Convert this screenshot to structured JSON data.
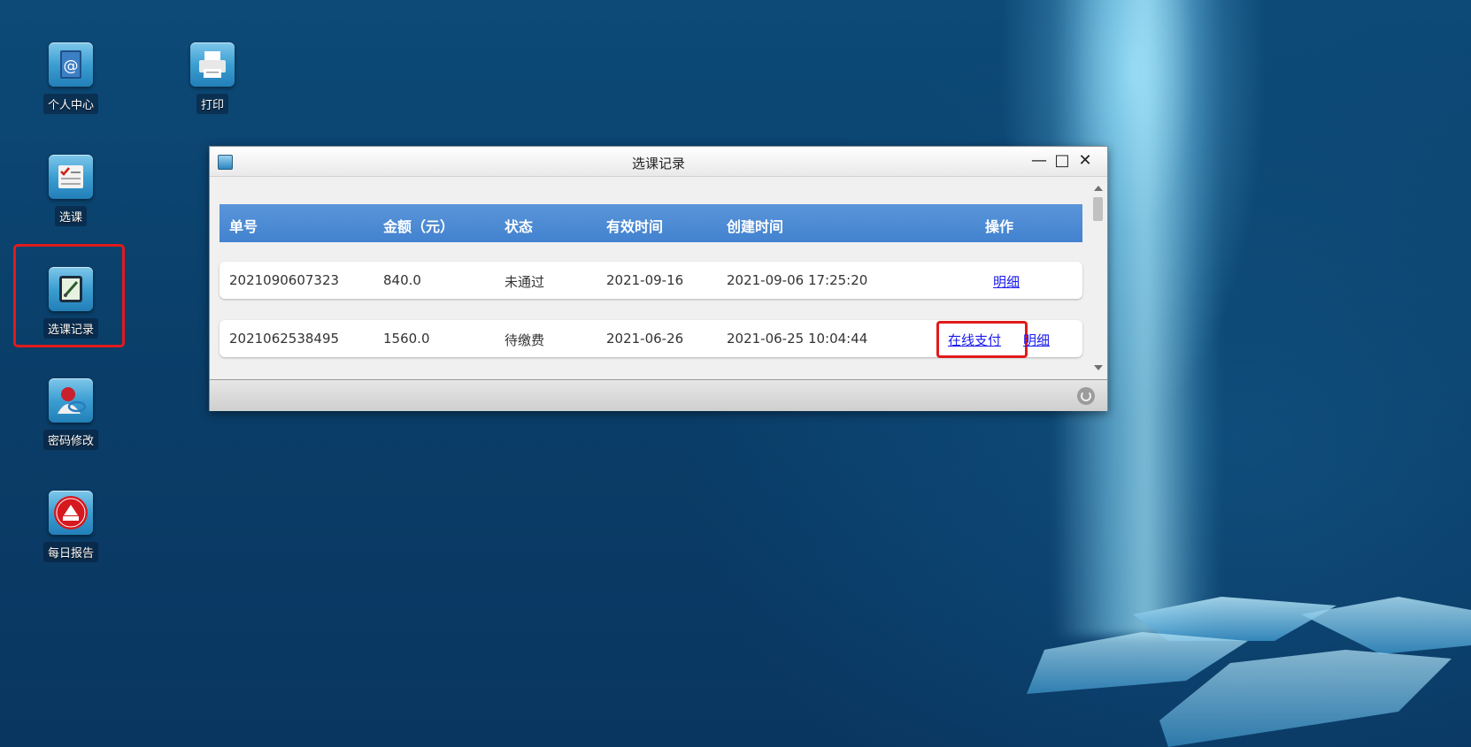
{
  "desktop": {
    "icons": [
      {
        "label": "个人中心",
        "icon": "address-book-icon"
      },
      {
        "label": "打印",
        "icon": "printer-icon"
      },
      {
        "label": "选课",
        "icon": "checklist-icon"
      },
      {
        "label": "选课记录",
        "icon": "notepad-icon"
      },
      {
        "label": "密码修改",
        "icon": "user-key-icon"
      },
      {
        "label": "每日报告",
        "icon": "report-badge-icon"
      }
    ]
  },
  "window": {
    "title": "选课记录",
    "controls": {
      "minimize": "—",
      "maximize": "□",
      "close": "✕"
    }
  },
  "table": {
    "columns": [
      "单号",
      "金额（元）",
      "状态",
      "有效时间",
      "创建时间",
      "操作"
    ],
    "rows": [
      {
        "order_no": "2021090607323",
        "amount": "840.0",
        "status": "未通过",
        "valid_time": "2021-09-16",
        "created_time": "2021-09-06 17:25:20",
        "actions": {
          "detail": "明细"
        }
      },
      {
        "order_no": "2021062538495",
        "amount": "1560.0",
        "status": "待缴费",
        "valid_time": "2021-06-26",
        "created_time": "2021-06-25 10:04:44",
        "actions": {
          "pay": "在线支付",
          "detail": "明细"
        }
      }
    ]
  },
  "colors": {
    "header_blue": "#4a8ad4",
    "highlight_red": "#e11b1b",
    "link_blue": "#1a1aee"
  }
}
